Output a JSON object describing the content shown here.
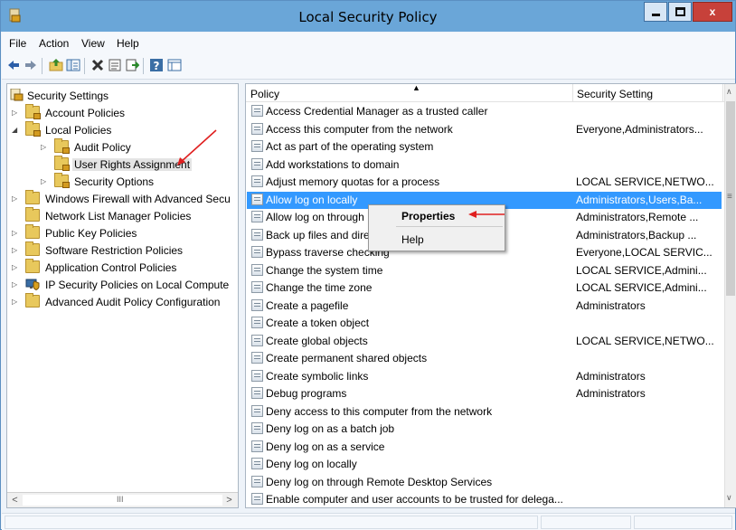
{
  "window": {
    "title": "Local Security Policy",
    "close_label": "x"
  },
  "menu": [
    "File",
    "Action",
    "View",
    "Help"
  ],
  "toolbar_icons": [
    "back-arrow-icon",
    "forward-arrow-icon",
    "up-folder-icon",
    "show-hide-tree-icon",
    "delete-icon",
    "properties-icon",
    "export-list-icon",
    "help-icon",
    "view-icon"
  ],
  "tree": {
    "root": "Security Settings",
    "items": [
      "Account Policies",
      "Local Policies",
      "Audit Policy",
      "User Rights Assignment",
      "Security Options",
      "Windows Firewall with Advanced Secu",
      "Network List Manager Policies",
      "Public Key Policies",
      "Software Restriction Policies",
      "Application Control Policies",
      "IP Security Policies on Local Compute",
      "Advanced Audit Policy Configuration"
    ],
    "scroll_grip": "III"
  },
  "columns": {
    "policy": "Policy",
    "setting": "Security Setting"
  },
  "policies": [
    {
      "name": "Access Credential Manager as a trusted caller",
      "setting": ""
    },
    {
      "name": "Access this computer from the network",
      "setting": "Everyone,Administrators..."
    },
    {
      "name": "Act as part of the operating system",
      "setting": ""
    },
    {
      "name": "Add workstations to domain",
      "setting": ""
    },
    {
      "name": "Adjust memory quotas for a process",
      "setting": "LOCAL SERVICE,NETWO..."
    },
    {
      "name": "Allow log on locally",
      "setting": "Administrators,Users,Ba..."
    },
    {
      "name": "Allow log on through",
      "setting": "Administrators,Remote ..."
    },
    {
      "name": "Back up files and dire",
      "setting": "Administrators,Backup ..."
    },
    {
      "name": "Bypass traverse checking",
      "setting": "Everyone,LOCAL SERVIC..."
    },
    {
      "name": "Change the system time",
      "setting": "LOCAL SERVICE,Admini..."
    },
    {
      "name": "Change the time zone",
      "setting": "LOCAL SERVICE,Admini..."
    },
    {
      "name": "Create a pagefile",
      "setting": "Administrators"
    },
    {
      "name": "Create a token object",
      "setting": ""
    },
    {
      "name": "Create global objects",
      "setting": "LOCAL SERVICE,NETWO..."
    },
    {
      "name": "Create permanent shared objects",
      "setting": ""
    },
    {
      "name": "Create symbolic links",
      "setting": "Administrators"
    },
    {
      "name": "Debug programs",
      "setting": "Administrators"
    },
    {
      "name": "Deny access to this computer from the network",
      "setting": ""
    },
    {
      "name": "Deny log on as a batch job",
      "setting": ""
    },
    {
      "name": "Deny log on as a service",
      "setting": ""
    },
    {
      "name": "Deny log on locally",
      "setting": ""
    },
    {
      "name": "Deny log on through Remote Desktop Services",
      "setting": ""
    },
    {
      "name": "Enable computer and user accounts to be trusted for delega...",
      "setting": ""
    }
  ],
  "context_menu": {
    "properties": "Properties",
    "help": "Help"
  },
  "colors": {
    "titlebar": "#6aa6d8",
    "selection": "#3399ff",
    "annotation_arrow": "#e02020"
  }
}
